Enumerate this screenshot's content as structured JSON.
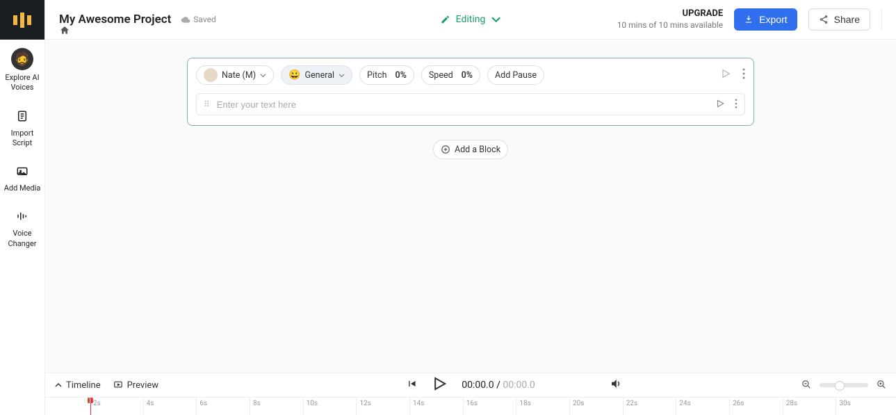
{
  "sidebar": {
    "items": [
      {
        "label": "Explore AI Voices"
      },
      {
        "label": "Import Script"
      },
      {
        "label": "Add Media"
      },
      {
        "label": "Voice Changer"
      }
    ]
  },
  "header": {
    "title": "My Awesome Project",
    "saved_label": "Saved",
    "mode_label": "Editing",
    "upgrade_label": "UPGRADE",
    "upgrade_sub": "10 mins of 10 mins available",
    "export_label": "Export",
    "share_label": "Share"
  },
  "block": {
    "voice_label": "Nate (M)",
    "style_label": "General",
    "pitch_label": "Pitch",
    "pitch_value": "0%",
    "speed_label": "Speed",
    "speed_value": "0%",
    "pause_label": "Add Pause",
    "placeholder": "Enter your text here"
  },
  "add_block_label": "Add a Block",
  "footer": {
    "timeline_label": "Timeline",
    "preview_label": "Preview",
    "time_current": "00:00.0",
    "time_total": "00:00.0",
    "ruler": [
      "2s",
      "4s",
      "6s",
      "8s",
      "10s",
      "12s",
      "14s",
      "16s",
      "18s",
      "20s",
      "22s",
      "24s",
      "26s",
      "28s",
      "30s"
    ]
  }
}
